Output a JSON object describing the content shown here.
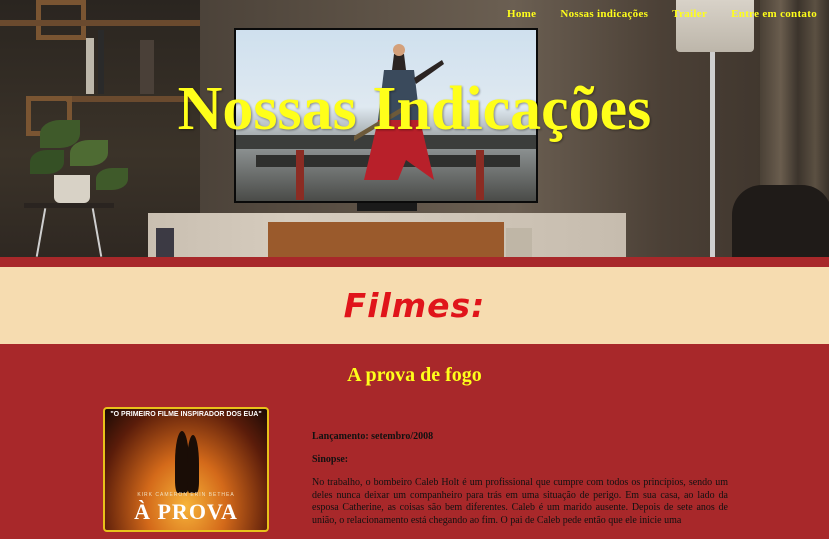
{
  "nav": {
    "items": [
      "Home",
      "Nossas indicações",
      "Trailer",
      "Entre em contato"
    ]
  },
  "hero": {
    "title": "Nossas Indicações"
  },
  "section": {
    "title": "Filmes:"
  },
  "movie": {
    "title": "A prova de fogo",
    "poster": {
      "tagline": "\"O PRIMEIRO FILME INSPIRADOR DOS EUA\"",
      "cast": "KIRK CAMERON    ERIN BETHEA",
      "title": "À PROVA"
    },
    "release": "Lançamento: setembro/2008",
    "synopsis_label": "Sinopse:",
    "synopsis": "No trabalho, o bombeiro Caleb Holt é um profissional que cumpre com todos os princípios, sendo um deles nunca deixar um companheiro para trás em uma situação de perigo. Em sua casa, ao lado da esposa Catherine, as coisas são bem diferentes. Caleb é um marido ausente. Depois de sete anos de união, o relacionamento está chegando ao fim. O pai de Caleb pede então que ele inicie uma"
  },
  "colors": {
    "accent_yellow": "#ffff1a",
    "background_red": "#a8282a",
    "header_band": "#f6dcb0",
    "section_title_red": "#e0141a"
  }
}
